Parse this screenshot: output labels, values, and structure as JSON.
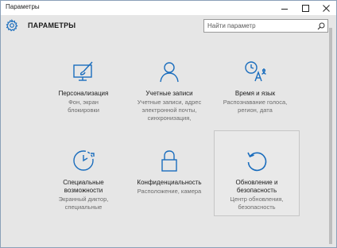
{
  "window": {
    "title": "Параметры",
    "controls": {
      "minimize": "minimize-icon",
      "maximize": "maximize-icon",
      "close": "close-icon"
    }
  },
  "header": {
    "title": "ПАРАМЕТРЫ",
    "search_placeholder": "Найти параметр",
    "search_value": ""
  },
  "colors": {
    "accent": "#1a6dbd",
    "background": "#e6e6e6"
  },
  "tiles": [
    {
      "name": "Персонализация",
      "desc": "Фон, экран блокировки",
      "icon": "personalization-icon"
    },
    {
      "name": "Учетные записи",
      "desc": "Учетные записи, адрес электронной почты, синхронизация,",
      "icon": "accounts-icon"
    },
    {
      "name": "Время и язык",
      "desc": "Распознавание голоса, регион, дата",
      "icon": "time-language-icon"
    },
    {
      "name": "Специальные возможности",
      "desc": "Экранный диктор, специальные",
      "icon": "ease-of-access-icon"
    },
    {
      "name": "Конфиденциальность",
      "desc": "Расположение, камера",
      "icon": "privacy-icon"
    },
    {
      "name": "Обновление и безопасность",
      "desc": "Центр обновления, безопасность",
      "icon": "update-security-icon"
    }
  ]
}
